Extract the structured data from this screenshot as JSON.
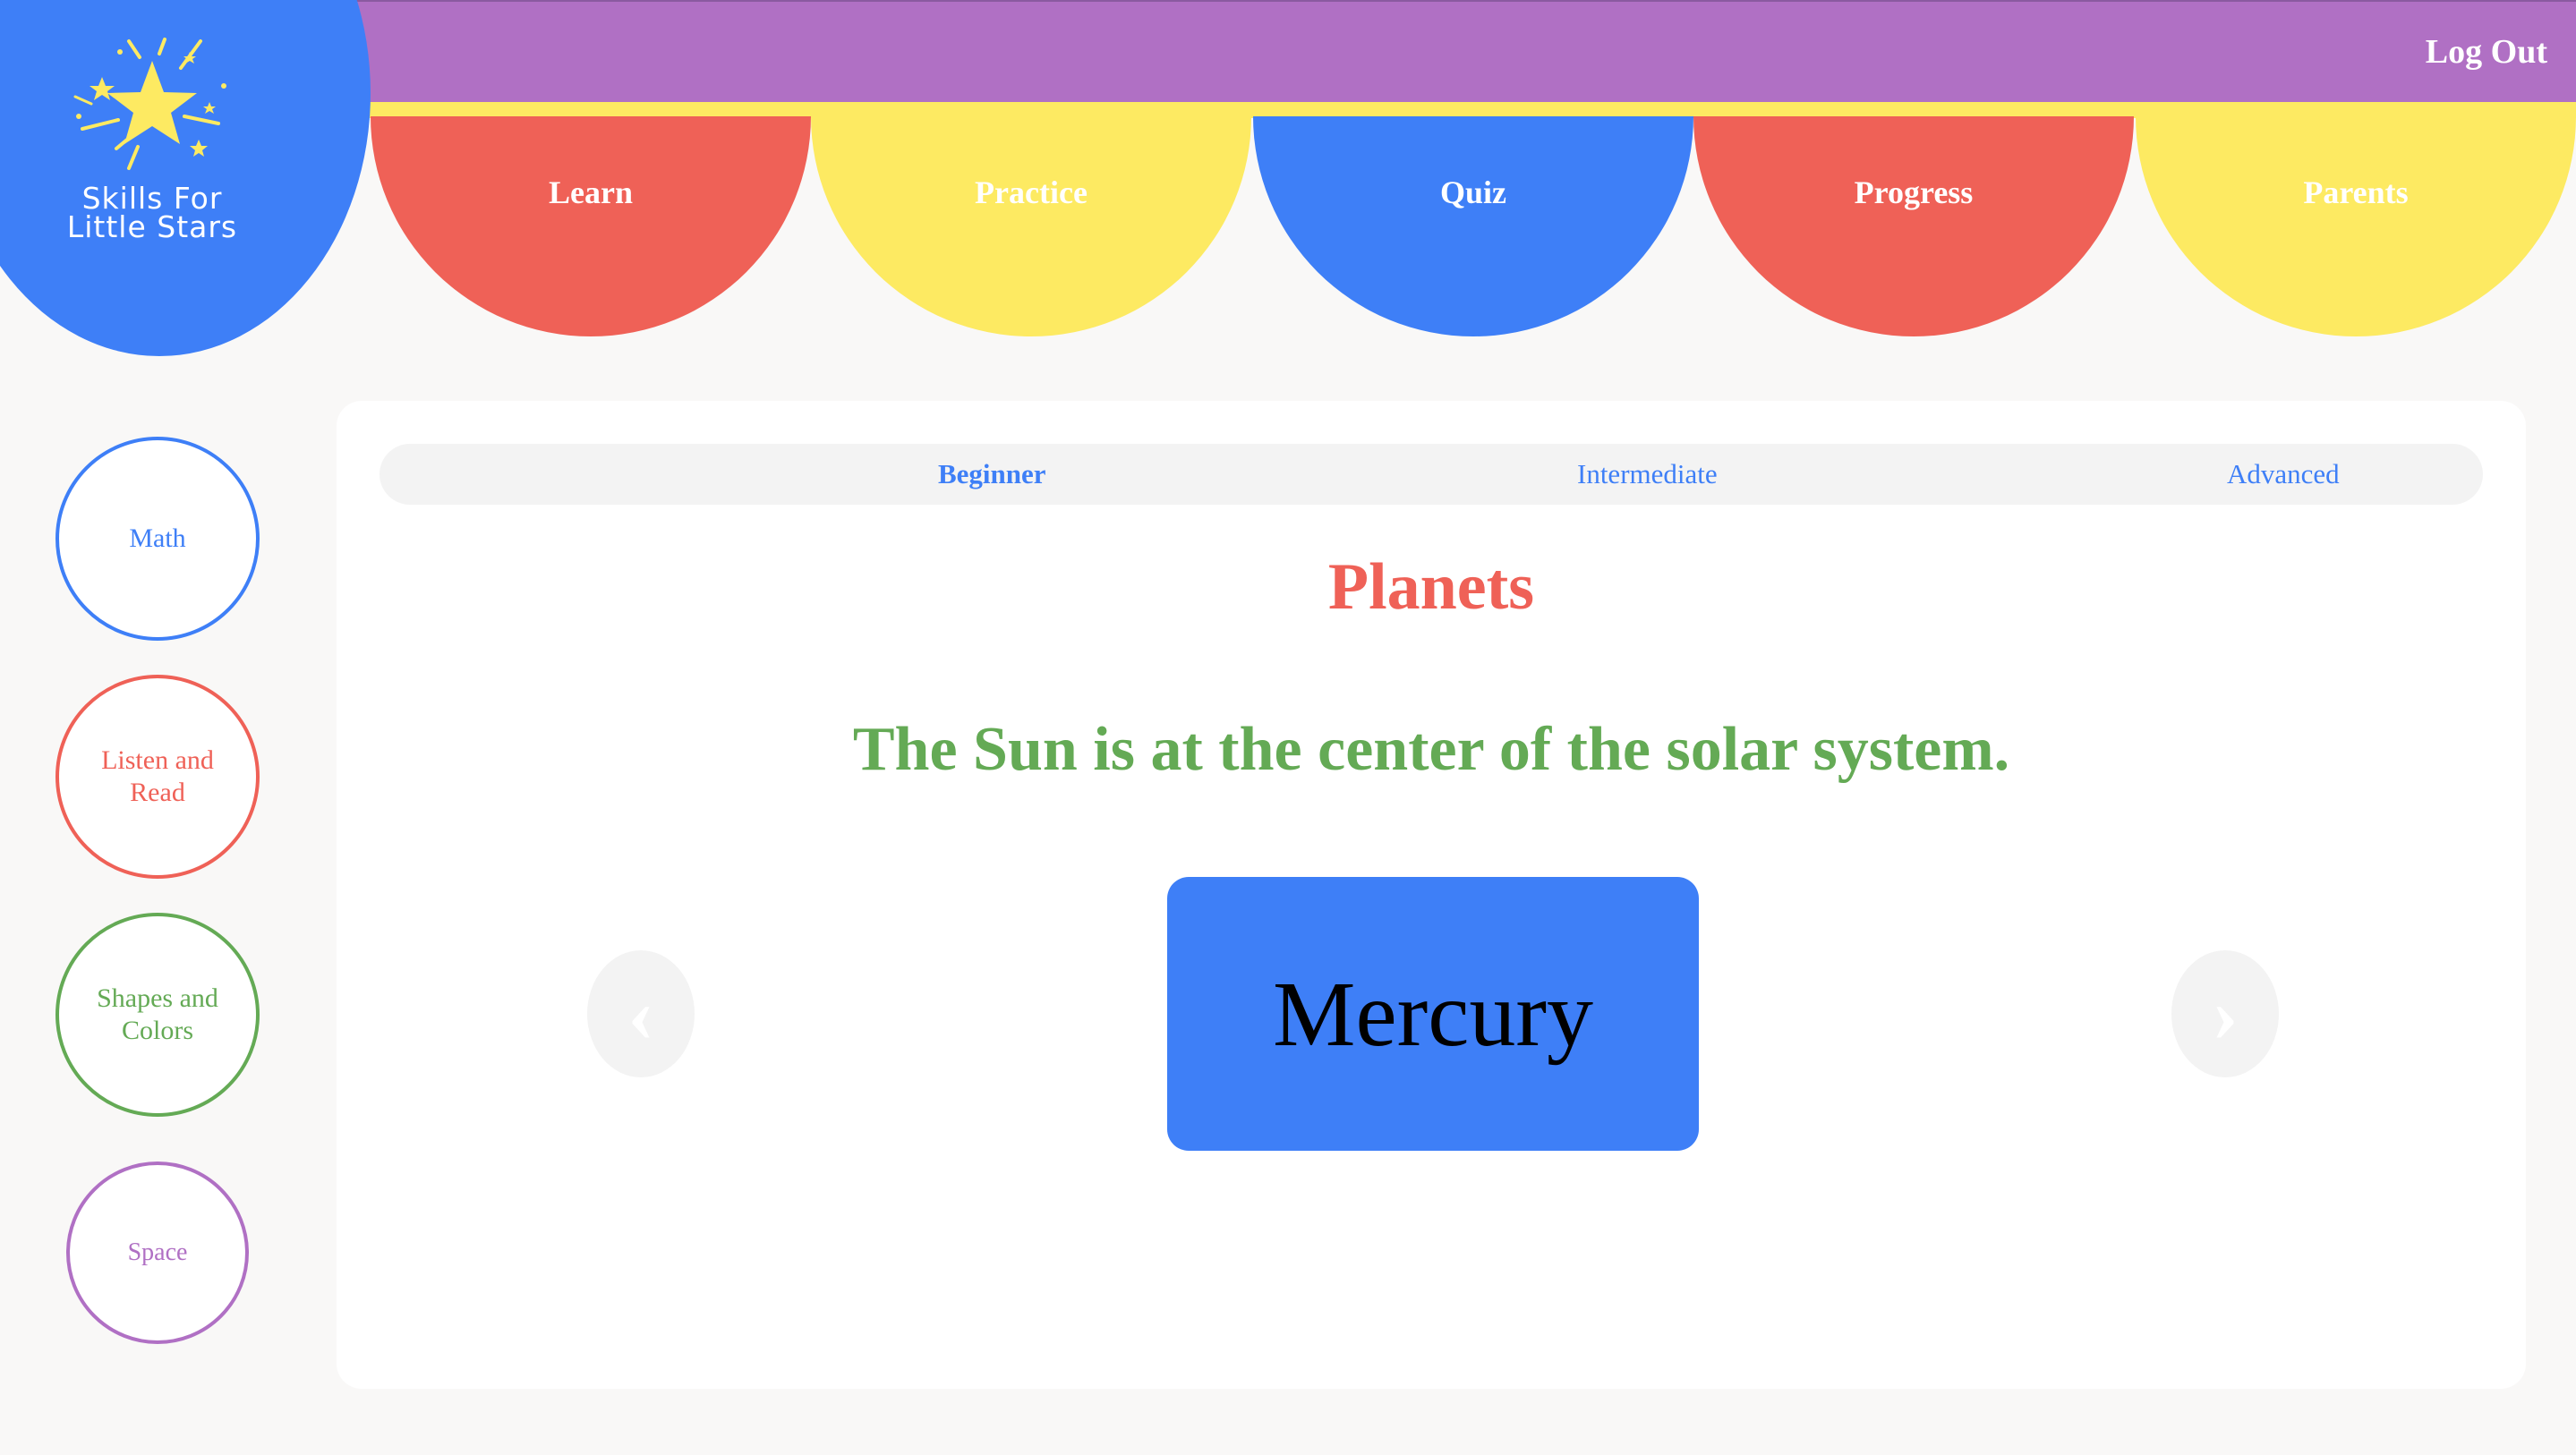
{
  "header": {
    "logout_label": "Log Out",
    "logo_line1": "Skills For",
    "logo_line2": "Little Stars"
  },
  "nav": {
    "tabs": [
      {
        "label": "Learn",
        "color": "#ef6157"
      },
      {
        "label": "Practice",
        "color": "#fdea62"
      },
      {
        "label": "Quiz",
        "color": "#3e7ff7"
      },
      {
        "label": "Progress",
        "color": "#ef6157"
      },
      {
        "label": "Parents",
        "color": "#fdea62"
      }
    ]
  },
  "sidebar": {
    "items": [
      {
        "label": "Math",
        "color": "#3e7ff7"
      },
      {
        "label": "Listen and Read",
        "color": "#ef6157"
      },
      {
        "label": "Shapes and Colors",
        "color": "#64aa55"
      },
      {
        "label": "Space",
        "color": "#b070c4"
      }
    ]
  },
  "levels": {
    "items": [
      "Beginner",
      "Intermediate",
      "Advanced"
    ],
    "selected": "Beginner"
  },
  "lesson": {
    "topic": "Planets",
    "fact": "The Sun is at the center of the solar system.",
    "card_label": "Mercury",
    "prev_icon": "‹",
    "next_icon": "›"
  },
  "icons": {
    "logo": "star-burst-icon",
    "prev": "chevron-left-icon",
    "next": "chevron-right-icon"
  }
}
